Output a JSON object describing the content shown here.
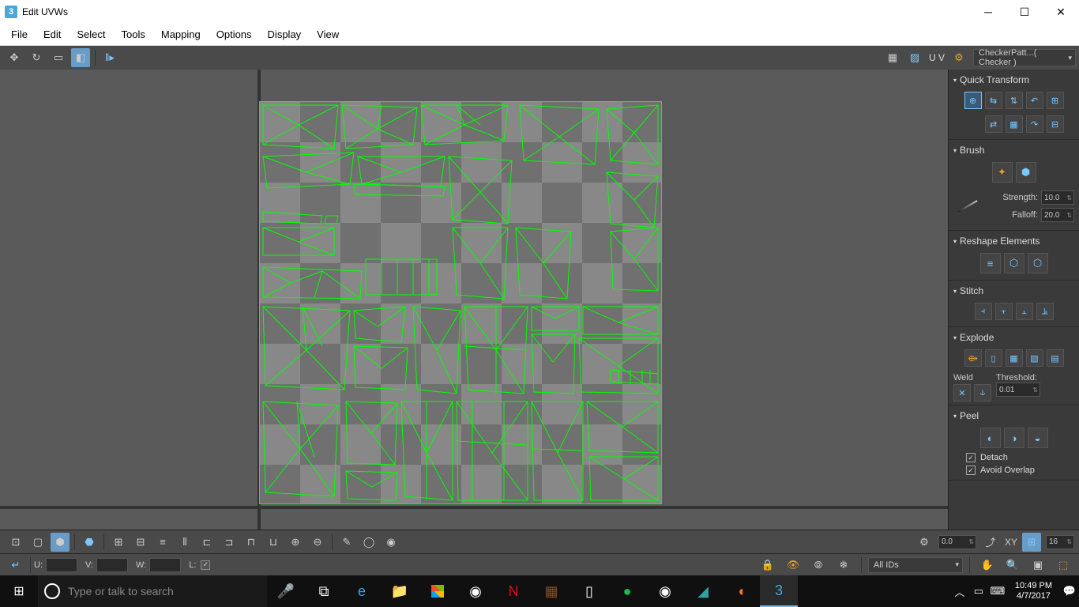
{
  "window": {
    "title": "Edit UVWs",
    "time": "10:49 PM",
    "date": "4/7/2017"
  },
  "menu": [
    "File",
    "Edit",
    "Select",
    "Tools",
    "Mapping",
    "Options",
    "Display",
    "View"
  ],
  "toolbar_right": {
    "uv_label": "U V",
    "texture_dropdown": "CheckerPatt...( Checker )"
  },
  "panel": {
    "quick_transform": "Quick Transform",
    "brush": {
      "title": "Brush",
      "strength_label": "Strength:",
      "strength": "10.0",
      "falloff_label": "Falloff:",
      "falloff": "20.0"
    },
    "reshape": {
      "title": "Reshape Elements"
    },
    "stitch": {
      "title": "Stitch"
    },
    "explode": {
      "title": "Explode",
      "weld_label": "Weld",
      "threshold_label": "Threshold:",
      "threshold": "0.01"
    },
    "peel": {
      "title": "Peel",
      "detach": "Detach",
      "avoid_overlap": "Avoid Overlap"
    }
  },
  "bottom": {
    "spinner_val": "0.0",
    "xy_label": "XY",
    "grid_val": "16",
    "u": "U:",
    "v": "V:",
    "w": "W:",
    "l": "L:",
    "ids_dropdown": "All IDs"
  },
  "search_placeholder": "Type or talk to search"
}
